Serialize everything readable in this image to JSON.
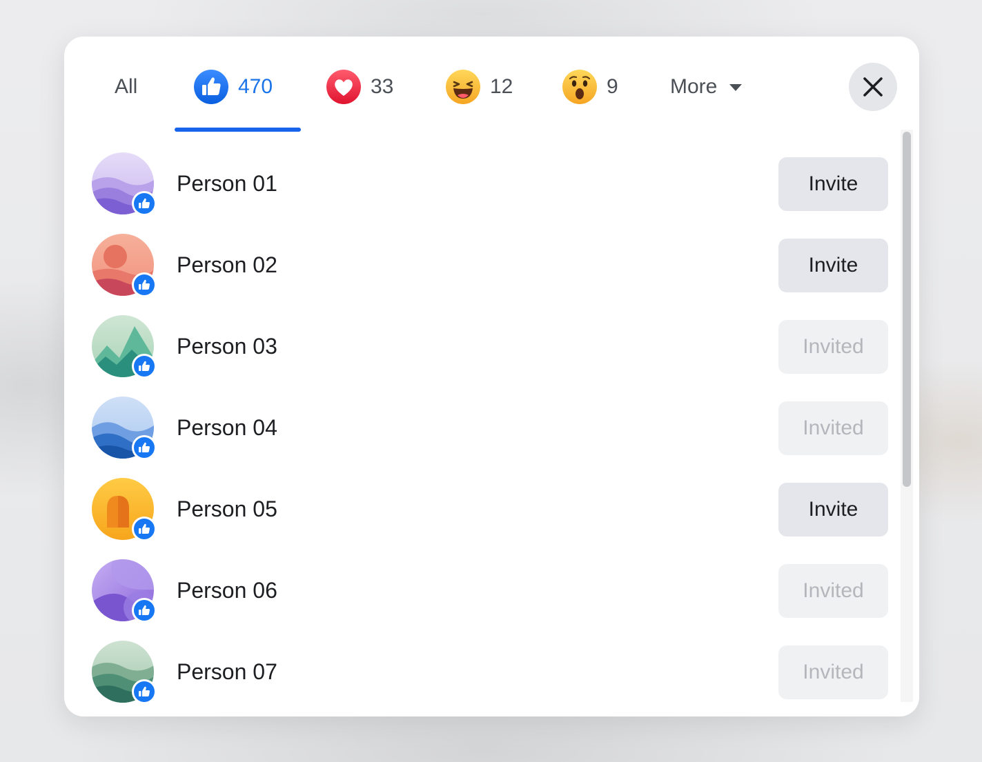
{
  "tabs": [
    {
      "label": "All",
      "icon": null,
      "active": false
    },
    {
      "label": "470",
      "icon": "like-reaction-icon",
      "active": true
    },
    {
      "label": "33",
      "icon": "love-reaction-icon",
      "active": false
    },
    {
      "label": "12",
      "icon": "haha-reaction-icon",
      "active": false
    },
    {
      "label": "9",
      "icon": "wow-reaction-icon",
      "active": false
    },
    {
      "label": "More",
      "icon": "caret-down-icon",
      "active": false
    }
  ],
  "colors": {
    "accent": "#1763ea",
    "like_badge": "#1877f2",
    "invite_bg": "#e4e6eb",
    "invited_bg": "#f0f1f3",
    "invited_text": "#b3b6bb"
  },
  "people": [
    {
      "name": "Person 01",
      "action": "Invite",
      "reaction": "like-badge-icon"
    },
    {
      "name": "Person 02",
      "action": "Invite",
      "reaction": "like-badge-icon"
    },
    {
      "name": "Person 03",
      "action": "Invited",
      "reaction": "like-badge-icon"
    },
    {
      "name": "Person 04",
      "action": "Invited",
      "reaction": "like-badge-icon"
    },
    {
      "name": "Person 05",
      "action": "Invite",
      "reaction": "like-badge-icon"
    },
    {
      "name": "Person 06",
      "action": "Invited",
      "reaction": "like-badge-icon"
    },
    {
      "name": "Person 07",
      "action": "Invited",
      "reaction": "like-badge-icon"
    }
  ]
}
